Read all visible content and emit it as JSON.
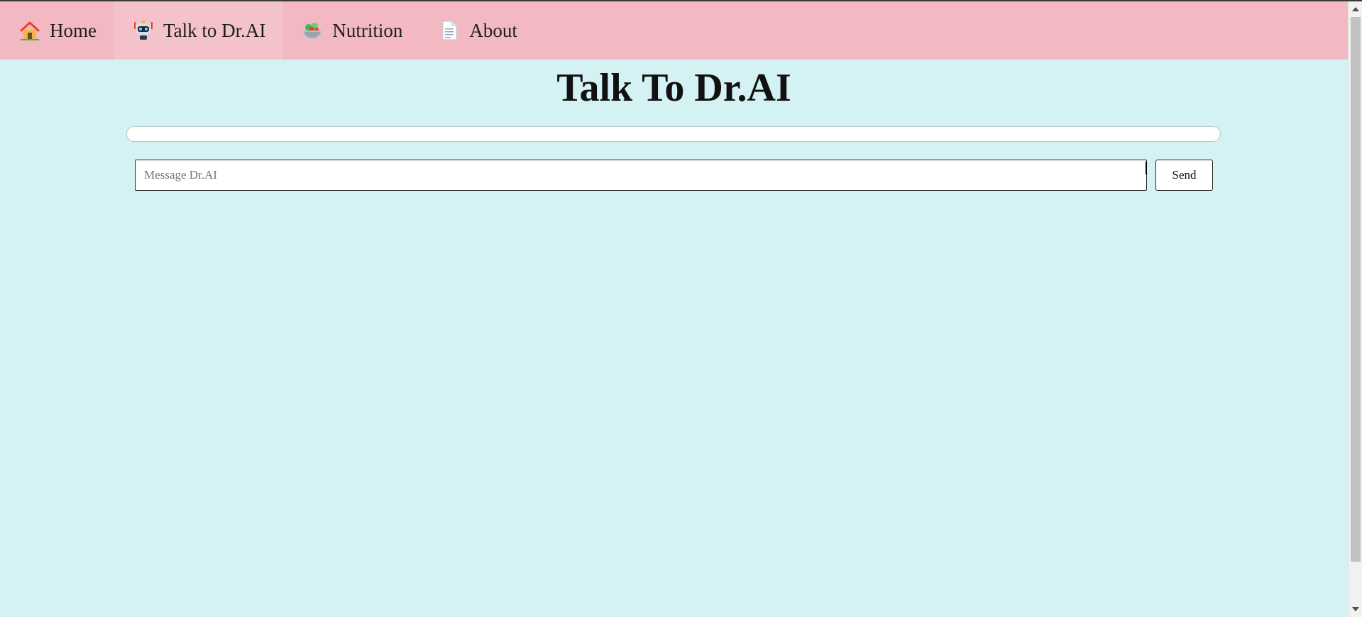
{
  "nav": {
    "items": [
      {
        "label": "Home",
        "icon": "house-icon",
        "active": false
      },
      {
        "label": "Talk to Dr.AI",
        "icon": "robot-icon",
        "active": true
      },
      {
        "label": "Nutrition",
        "icon": "salad-bowl-icon",
        "active": false
      },
      {
        "label": "About",
        "icon": "document-icon",
        "active": false
      }
    ]
  },
  "main": {
    "title": "Talk To Dr.AI",
    "message_input": {
      "placeholder": "Message Dr.AI",
      "value": ""
    },
    "send_label": "Send"
  },
  "colors": {
    "nav_background": "#f2b9c3",
    "nav_active": "#f4c2cb",
    "page_background": "#d4f2f4"
  }
}
